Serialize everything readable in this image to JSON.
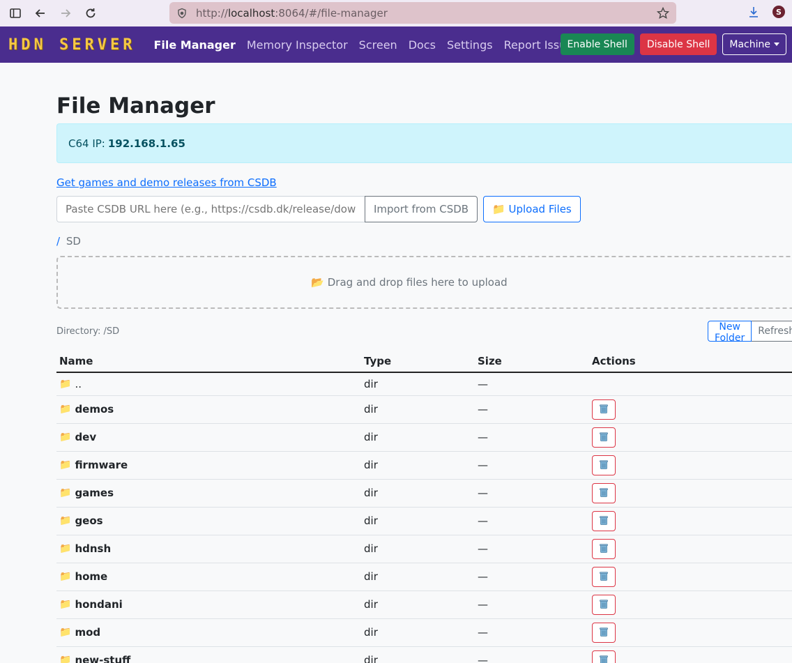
{
  "browser": {
    "url_prefix": "http://",
    "url_host": "localhost",
    "url_rest": ":8064/#/file-manager",
    "profile_initial": "S"
  },
  "navbar": {
    "brand": "HDN SERVER",
    "links": [
      "File Manager",
      "Memory Inspector",
      "Screen",
      "Docs",
      "Settings",
      "Report Issue"
    ],
    "enable_shell": "Enable Shell",
    "disable_shell": "Disable Shell",
    "machine": "Machine"
  },
  "page": {
    "title": "File Manager",
    "ip_label": "C64 IP:",
    "ip_value": "192.168.1.65",
    "csdb_link": "Get games and demo releases from CSDB",
    "csdb_placeholder": "Paste CSDB URL here (e.g., https://csdb.dk/release/downl",
    "import_button": "Import from CSDB",
    "upload_button": "📁 Upload Files",
    "breadcrumb_root": "/",
    "breadcrumb_current": "SD",
    "dropzone_text": "📂 Drag and drop files here to upload",
    "directory_label": "Directory: /SD",
    "new_folder": "New Folder",
    "refresh": "Refresh"
  },
  "table": {
    "headers": [
      "Name",
      "Type",
      "Size",
      "Actions"
    ],
    "parent": {
      "name": "..",
      "type": "dir",
      "size": "—"
    },
    "rows": [
      {
        "name": "demos",
        "type": "dir",
        "size": "—"
      },
      {
        "name": "dev",
        "type": "dir",
        "size": "—"
      },
      {
        "name": "firmware",
        "type": "dir",
        "size": "—"
      },
      {
        "name": "games",
        "type": "dir",
        "size": "—"
      },
      {
        "name": "geos",
        "type": "dir",
        "size": "—"
      },
      {
        "name": "hdnsh",
        "type": "dir",
        "size": "—"
      },
      {
        "name": "home",
        "type": "dir",
        "size": "—"
      },
      {
        "name": "hondani",
        "type": "dir",
        "size": "—"
      },
      {
        "name": "mod",
        "type": "dir",
        "size": "—"
      },
      {
        "name": "new-stuff",
        "type": "dir",
        "size": "—"
      }
    ]
  },
  "icons": {
    "folder": "📁",
    "trash": "trash-icon"
  },
  "colors": {
    "navbar": "#4a2d8e",
    "brand": "#f6c744",
    "primary": "#0d6efd",
    "success": "#198754",
    "danger": "#dc3545",
    "info_bg": "#cff4fc"
  }
}
